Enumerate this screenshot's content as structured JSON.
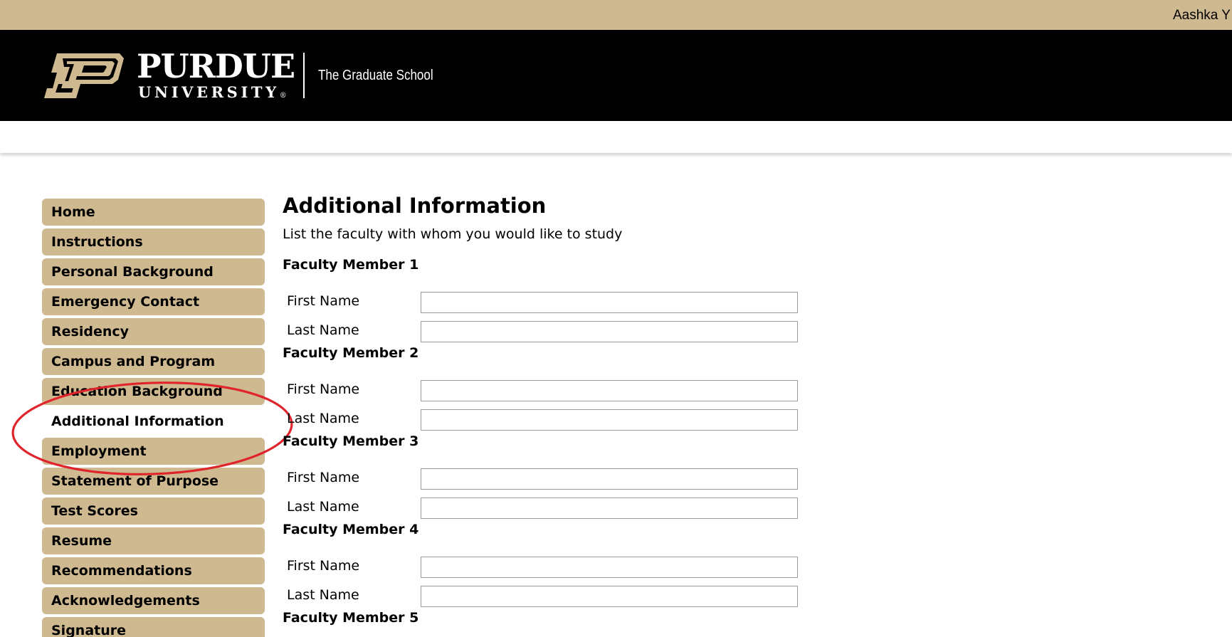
{
  "topbar": {
    "user_name": "Aashka Y"
  },
  "header": {
    "wordmark_top": "PURDUE",
    "wordmark_bottom": "UNIVERSITY",
    "registered_mark": "®",
    "school_name": "The Graduate School"
  },
  "colors": {
    "gold": "#cfb991",
    "black": "#000000",
    "highlight_oval": "#e0242c"
  },
  "sidebar": {
    "items": [
      {
        "label": "Home",
        "active": false
      },
      {
        "label": "Instructions",
        "active": false
      },
      {
        "label": "Personal Background",
        "active": false
      },
      {
        "label": "Emergency Contact",
        "active": false
      },
      {
        "label": "Residency",
        "active": false
      },
      {
        "label": "Campus and Program",
        "active": false
      },
      {
        "label": "Education Background",
        "active": false
      },
      {
        "label": "Additional Information",
        "active": true
      },
      {
        "label": "Employment",
        "active": false
      },
      {
        "label": "Statement of Purpose",
        "active": false
      },
      {
        "label": "Test Scores",
        "active": false
      },
      {
        "label": "Resume",
        "active": false
      },
      {
        "label": "Recommendations",
        "active": false
      },
      {
        "label": "Acknowledgements",
        "active": false
      },
      {
        "label": "Signature",
        "active": false
      }
    ]
  },
  "main": {
    "title": "Additional Information",
    "intro": "List the faculty with whom you would like to study",
    "faculty": [
      {
        "label": "Faculty Member 1",
        "first_label": "First Name",
        "last_label": "Last Name",
        "first_value": "",
        "last_value": ""
      },
      {
        "label": "Faculty Member 2",
        "first_label": "First Name",
        "last_label": "Last Name",
        "first_value": "",
        "last_value": ""
      },
      {
        "label": "Faculty Member 3",
        "first_label": "First Name",
        "last_label": "Last Name",
        "first_value": "",
        "last_value": ""
      },
      {
        "label": "Faculty Member 4",
        "first_label": "First Name",
        "last_label": "Last Name",
        "first_value": "",
        "last_value": ""
      },
      {
        "label": "Faculty Member 5"
      }
    ]
  }
}
